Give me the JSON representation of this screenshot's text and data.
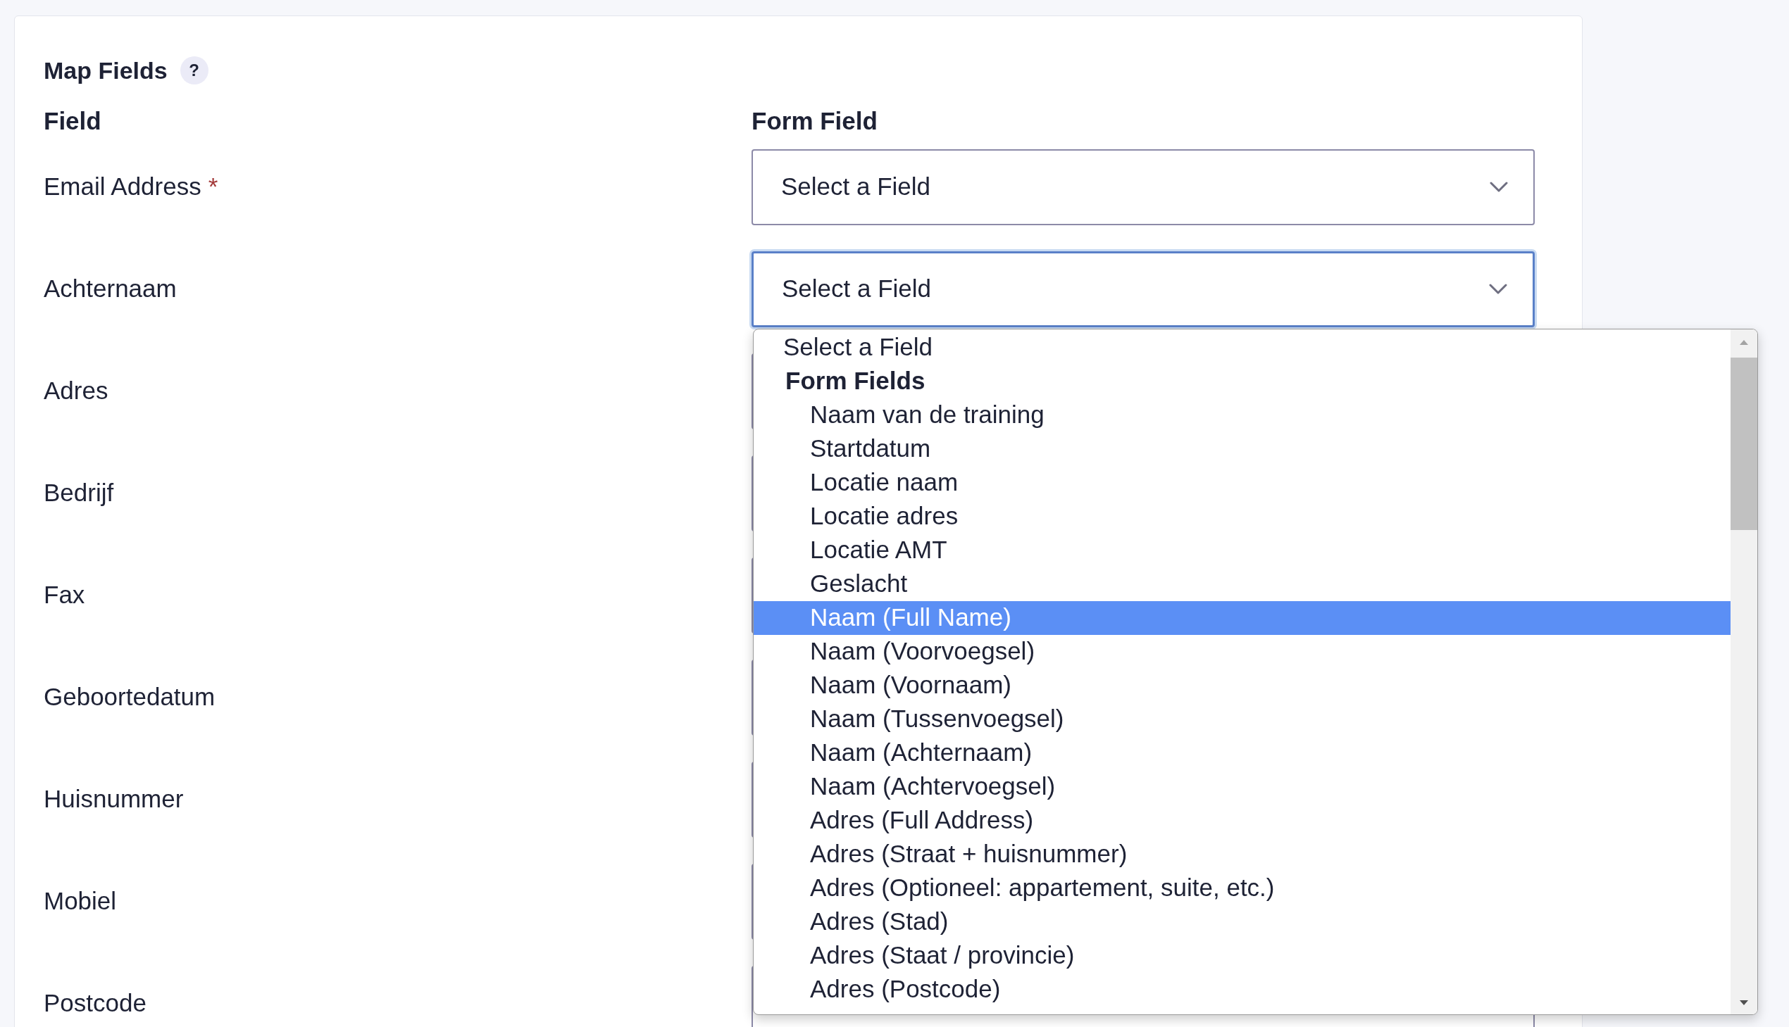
{
  "section": {
    "title": "Map Fields",
    "help": "?"
  },
  "columns": [
    "Field",
    "Form Field"
  ],
  "rows": [
    {
      "label": "Email Address",
      "required_mark": "*",
      "select": {
        "value": "Select a Field",
        "focused": false
      }
    },
    {
      "label": "Achternaam",
      "select": {
        "value": "Select a Field",
        "focused": true
      }
    },
    {
      "label": "Adres",
      "select": {
        "focused": false
      }
    },
    {
      "label": "Bedrijf",
      "select": {
        "focused": false
      }
    },
    {
      "label": "Fax",
      "select": {
        "focused": false
      }
    },
    {
      "label": "Geboortedatum",
      "select": {
        "focused": false
      }
    },
    {
      "label": "Huisnummer",
      "select": {
        "focused": false
      }
    },
    {
      "label": "Mobiel",
      "select": {
        "focused": false
      }
    },
    {
      "label": "Postcode",
      "select": {
        "focused": false
      }
    }
  ],
  "dropdown": {
    "options": [
      {
        "kind": "option",
        "label": "Select a Field",
        "selected": false
      },
      {
        "kind": "group",
        "label": "Form Fields"
      },
      {
        "kind": "child",
        "label": "Naam van de training",
        "selected": false
      },
      {
        "kind": "child",
        "label": "Startdatum",
        "selected": false
      },
      {
        "kind": "child",
        "label": "Locatie naam",
        "selected": false
      },
      {
        "kind": "child",
        "label": "Locatie adres",
        "selected": false
      },
      {
        "kind": "child",
        "label": "Locatie AMT",
        "selected": false
      },
      {
        "kind": "child",
        "label": "Geslacht",
        "selected": false
      },
      {
        "kind": "child",
        "label": "Naam (Full Name)",
        "selected": true
      },
      {
        "kind": "child",
        "label": "Naam (Voorvoegsel)",
        "selected": false
      },
      {
        "kind": "child",
        "label": "Naam (Voornaam)",
        "selected": false
      },
      {
        "kind": "child",
        "label": "Naam (Tussenvoegsel)",
        "selected": false
      },
      {
        "kind": "child",
        "label": "Naam (Achternaam)",
        "selected": false
      },
      {
        "kind": "child",
        "label": "Naam (Achtervoegsel)",
        "selected": false
      },
      {
        "kind": "child",
        "label": "Adres (Full Address)",
        "selected": false
      },
      {
        "kind": "child",
        "label": "Adres (Straat + huisnummer)",
        "selected": false
      },
      {
        "kind": "child",
        "label": "Adres (Optioneel: appartement, suite, etc.)",
        "selected": false
      },
      {
        "kind": "child",
        "label": "Adres (Stad)",
        "selected": false
      },
      {
        "kind": "child",
        "label": "Adres (Staat / provincie)",
        "selected": false
      },
      {
        "kind": "child",
        "label": "Adres (Postcode)",
        "selected": false
      }
    ]
  }
}
